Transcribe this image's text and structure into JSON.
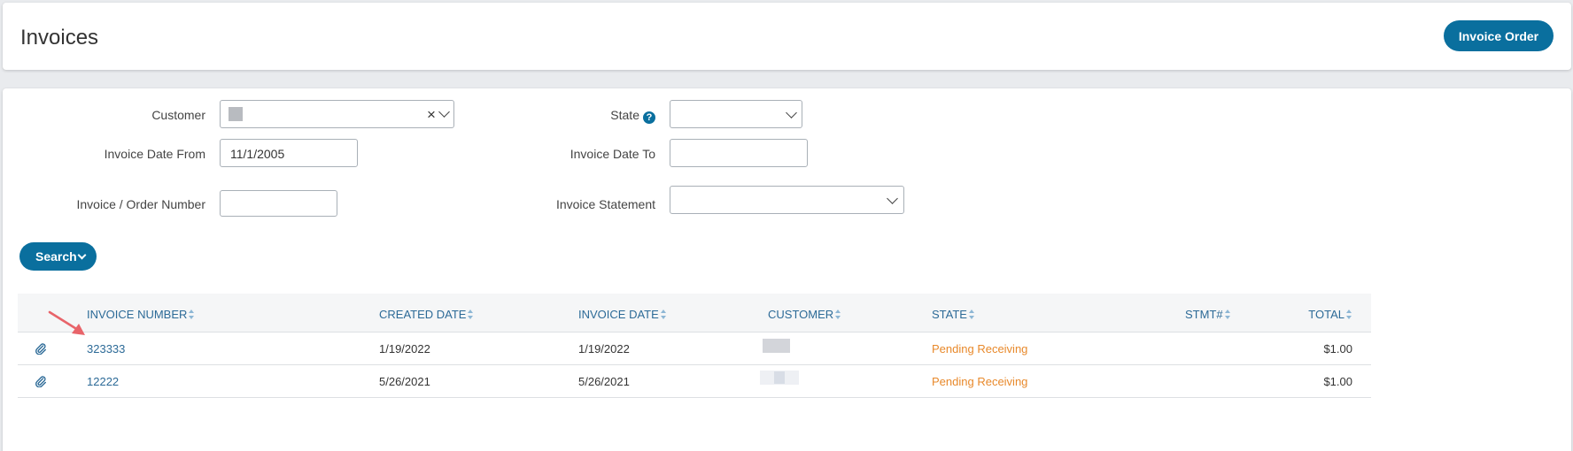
{
  "header": {
    "title": "Invoices",
    "invoice_order_label": "Invoice Order"
  },
  "filters": {
    "customer_label": "Customer",
    "customer_clear": "×",
    "state_label": "State",
    "help_glyph": "?",
    "invoice_date_from_label": "Invoice Date From",
    "invoice_date_from_value": "11/1/2005",
    "invoice_date_to_label": "Invoice Date To",
    "invoice_date_to_value": "",
    "order_number_label": "Invoice / Order Number",
    "order_number_value": "",
    "statement_label": "Invoice Statement",
    "search_label": "Search"
  },
  "grid": {
    "columns": [
      "Invoice Number",
      "Created Date",
      "Invoice Date",
      "Customer",
      "State",
      "Stmt#",
      "Total"
    ],
    "rows": [
      {
        "invoice_number": "323333",
        "created_date": "1/19/2022",
        "invoice_date": "1/19/2022",
        "state": "Pending Receiving",
        "stmt": "",
        "total": "$1.00"
      },
      {
        "invoice_number": "12222",
        "created_date": "5/26/2021",
        "invoice_date": "5/26/2021",
        "state": "Pending Receiving",
        "stmt": "",
        "total": "$1.00"
      }
    ]
  },
  "colors": {
    "primary": "#0a6f9e",
    "link": "#2c6a97",
    "state_pending": "#e8892b",
    "annotation_arrow": "#e8646a"
  },
  "icons": [
    "chevron-down-icon",
    "clear-icon",
    "help-icon",
    "sort-icon",
    "paperclip-icon",
    "annotation-arrow"
  ]
}
